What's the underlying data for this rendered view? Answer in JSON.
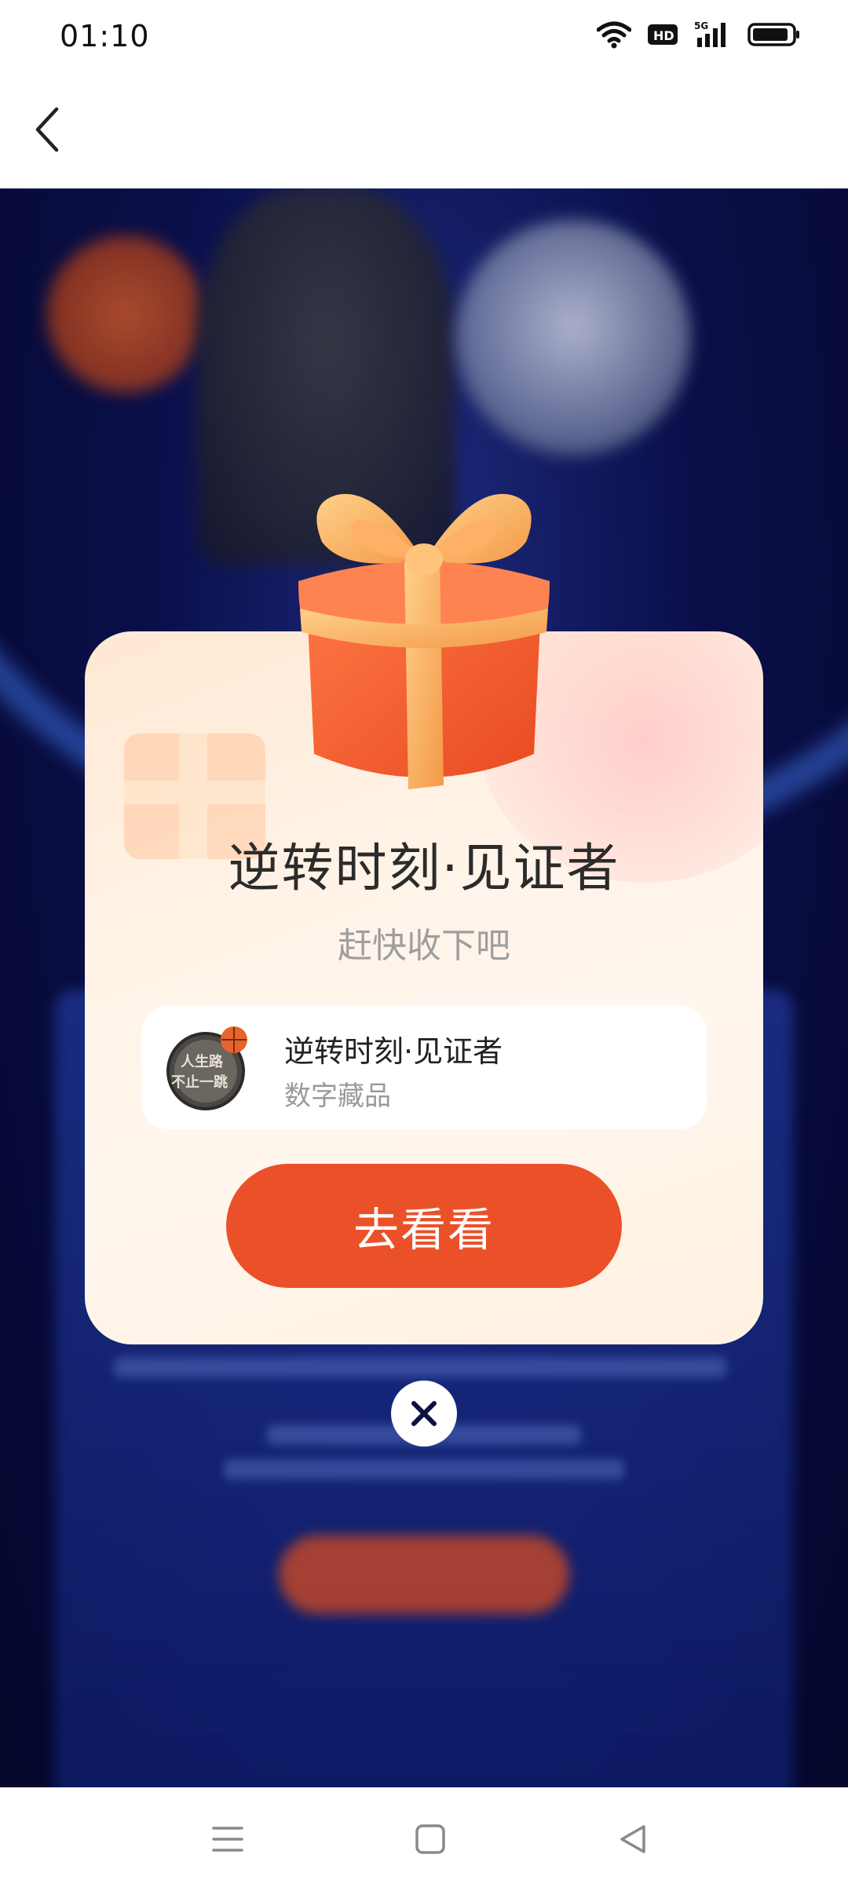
{
  "status_bar": {
    "time": "01:10",
    "icons": [
      "wifi-icon",
      "hd-icon",
      "5g-signal-icon",
      "battery-icon"
    ],
    "hd_label": "HD",
    "network_label": "5G"
  },
  "header": {
    "back_icon": "chevron-left-icon"
  },
  "dialog": {
    "title": "逆转时刻·见证者",
    "subtitle": "赶快收下吧",
    "item": {
      "name": "逆转时刻·见证者",
      "type": "数字藏品",
      "badge_text_line1": "人生路",
      "badge_text_line2": "不止一跳"
    },
    "primary_button_label": "去看看",
    "close_icon": "close-icon"
  },
  "nav_bar": {
    "icons": [
      "menu-icon",
      "home-icon",
      "back-triangle-icon"
    ]
  },
  "colors": {
    "accent": "#ea5129",
    "background": "#070a3a",
    "dialog_bg": "#fff4ea"
  }
}
